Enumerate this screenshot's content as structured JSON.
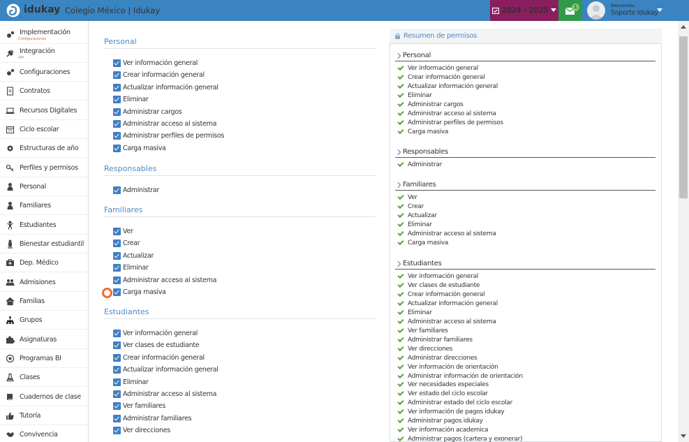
{
  "header": {
    "logo": "idukay",
    "separator": ":",
    "school": "Colegio México | Idukay",
    "year": "2024 - 2025",
    "messages_count": "1",
    "welcome": "Bienvenido,",
    "user": "Soporte Idukay",
    "colors": {
      "bar": "#3a84c2",
      "year": "#8a1e5e",
      "messages": "#2e9a4a"
    }
  },
  "sidebar": {
    "items": [
      {
        "label": "Implementación",
        "sub": "Configuraciones",
        "icon": "gears-icon"
      },
      {
        "label": "Integración",
        "sub": "API",
        "icon": "plug-icon"
      },
      {
        "label": "Configuraciones",
        "icon": "gears-icon"
      },
      {
        "label": "Contratos",
        "icon": "document-icon"
      },
      {
        "label": "Recursos Digitales",
        "icon": "laptop-icon"
      },
      {
        "label": "Ciclo escolar",
        "icon": "calendar-icon"
      },
      {
        "label": "Estructuras de año",
        "icon": "gear-icon"
      },
      {
        "label": "Perfiles y permisos",
        "icon": "key-icon"
      },
      {
        "label": "Personal",
        "icon": "user-icon"
      },
      {
        "label": "Familiares",
        "icon": "user-icon"
      },
      {
        "label": "Estudiantes",
        "icon": "child-icon"
      },
      {
        "label": "Bienestar estudiantil",
        "icon": "person-icon"
      },
      {
        "label": "Dep. Médico",
        "icon": "medkit-icon"
      },
      {
        "label": "Admisiones",
        "icon": "users-icon"
      },
      {
        "label": "Familias",
        "icon": "home-icon"
      },
      {
        "label": "Grupos",
        "icon": "sitemap-icon"
      },
      {
        "label": "Asignaturas",
        "icon": "puzzle-icon"
      },
      {
        "label": "Programas BI",
        "icon": "globe-icon"
      },
      {
        "label": "Clases",
        "icon": "flask-icon"
      },
      {
        "label": "Cuadernos de clase",
        "icon": "book-icon"
      },
      {
        "label": "Tutoría",
        "icon": "thumbs-up-icon"
      },
      {
        "label": "Convivencia",
        "icon": "handshake-icon"
      }
    ]
  },
  "permissions": {
    "sections": [
      {
        "title": "Personal",
        "items": [
          "Ver información general",
          "Crear información general",
          "Actualizar información general",
          "Eliminar",
          "Administrar cargos",
          "Administrar acceso al sistema",
          "Administrar perfiles de permisos",
          "Carga masiva"
        ]
      },
      {
        "title": "Responsables",
        "items": [
          "Administrar"
        ]
      },
      {
        "title": "Familiares",
        "items": [
          "Ver",
          "Crear",
          "Actualizar",
          "Eliminar",
          "Administrar acceso al sistema",
          "Carga masiva"
        ]
      },
      {
        "title": "Estudiantes",
        "items": [
          "Ver información general",
          "Ver clases de estudiante",
          "Crear información general",
          "Actualizar información general",
          "Eliminar",
          "Administrar acceso al sistema",
          "Ver familiares",
          "Administrar familiares",
          "Ver direcciones"
        ]
      }
    ]
  },
  "summary": {
    "title": "Resumen de permisos",
    "groups": [
      {
        "title": "Personal",
        "items": [
          "Ver información general",
          "Crear información general",
          "Actualizar información general",
          "Eliminar",
          "Administrar cargos",
          "Administrar acceso al sistema",
          "Administrar perfiles de permisos",
          "Carga masiva"
        ]
      },
      {
        "title": "Responsables",
        "items": [
          "Administrar"
        ]
      },
      {
        "title": "Familiares",
        "items": [
          "Ver",
          "Crear",
          "Actualizar",
          "Eliminar",
          "Administrar acceso al sistema",
          "Carga masiva"
        ]
      },
      {
        "title": "Estudiantes",
        "items": [
          "Ver información general",
          "Ver clases de estudiante",
          "Crear información general",
          "Actualizar información general",
          "Eliminar",
          "Administrar acceso al sistema",
          "Ver familiares",
          "Administrar familiares",
          "Ver direcciones",
          "Administrar direcciones",
          "Ver información de orientación",
          "Administrar información de orientación",
          "Ver necesidades especiales",
          "Ver estado del ciclo escolar",
          "Administrar estado del ciclo escolar",
          "Ver información de pagos idukay",
          "Administrar pagos idukay",
          "Ver información academica",
          "Administrar pagos (cartera y exonerar)"
        ]
      }
    ]
  }
}
